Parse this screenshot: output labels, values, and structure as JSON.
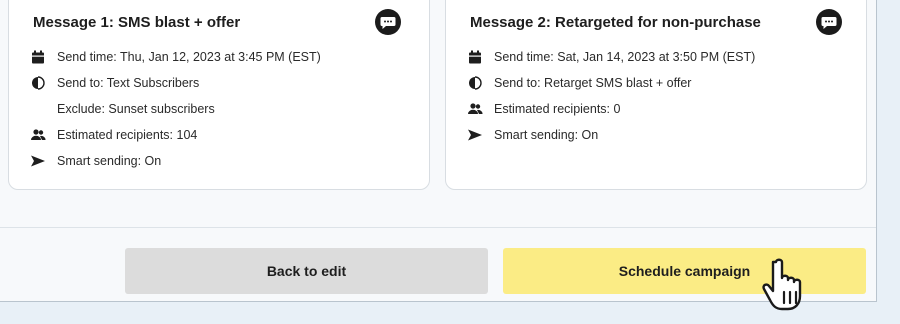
{
  "messages": [
    {
      "title": "Message 1: SMS blast + offer",
      "icon": "chat-bubble-icon",
      "send_time": "Send time: Thu, Jan 12, 2023 at 3:45 PM (EST)",
      "send_to": "Send to: Text Subscribers",
      "exclude": "Exclude: Sunset subscribers",
      "recipients": "Estimated recipients: 104",
      "smart_sending": "Smart sending: On"
    },
    {
      "title": "Message 2: Retargeted for non-purchase",
      "icon": "chat-bubble-icon",
      "send_time": "Send time: Sat, Jan 14, 2023 at 3:50 PM (EST)",
      "send_to": "Send to: Retarget SMS blast + offer",
      "recipients": "Estimated recipients: 0",
      "smart_sending": "Smart sending: On"
    }
  ],
  "footer": {
    "back_label": "Back to edit",
    "schedule_label": "Schedule campaign"
  },
  "colors": {
    "schedule_button": "#fbec85",
    "back_button": "#dcdcdc",
    "page_background": "#e8f0f7"
  }
}
